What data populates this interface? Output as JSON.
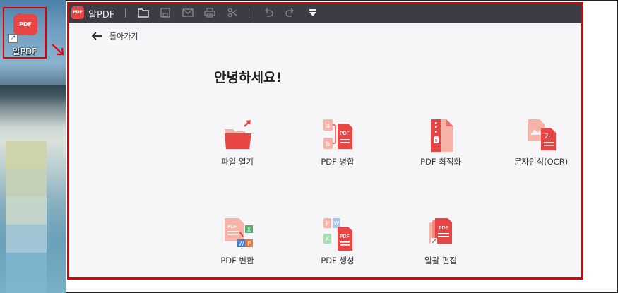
{
  "desktop": {
    "icon_label": "알PDF",
    "icon_badge": "PDF"
  },
  "app": {
    "title": "알PDF",
    "logo_text": "PDF",
    "toolbar": [
      {
        "name": "open-folder-icon"
      },
      {
        "name": "save-icon"
      },
      {
        "name": "mail-icon"
      },
      {
        "name": "print-icon"
      },
      {
        "name": "scissors-icon"
      },
      {
        "name": "undo-icon"
      },
      {
        "name": "redo-icon"
      },
      {
        "name": "dropdown-menu-icon"
      }
    ],
    "back_label": "돌아가기",
    "greeting": "안녕하세요!",
    "tiles": [
      {
        "label": "파일 열기",
        "icon": "open-file-icon"
      },
      {
        "label": "PDF 병합",
        "icon": "merge-pdf-icon"
      },
      {
        "label": "PDF 최적화",
        "icon": "optimize-pdf-icon"
      },
      {
        "label": "문자인식(OCR)",
        "icon": "ocr-icon"
      },
      {
        "label": "PDF 변환",
        "icon": "convert-pdf-icon"
      },
      {
        "label": "PDF 생성",
        "icon": "create-pdf-icon"
      },
      {
        "label": "일괄 편집",
        "icon": "batch-edit-icon"
      }
    ],
    "merge_icon_letters": [
      "a",
      "b"
    ],
    "create_icon_letters": [
      "P",
      "W",
      "X"
    ],
    "convert_icon_letters": [
      "X",
      "W",
      "P"
    ],
    "ocr_icon_letter": "가"
  },
  "colors": {
    "accent": "#e84545",
    "highlight": "#e10000",
    "titlebar": "#3c3c44",
    "background": "#f6f6f9"
  }
}
